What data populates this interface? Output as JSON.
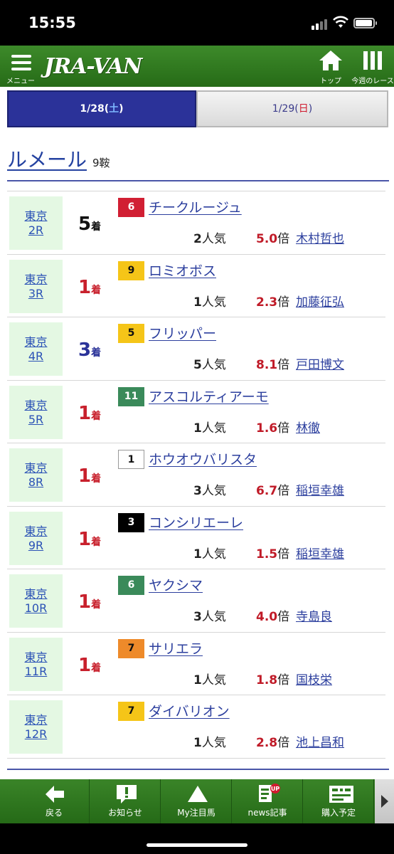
{
  "status_bar": {
    "time": "15:55"
  },
  "header": {
    "menu_label": "メニュー",
    "logo": "JRA-VAN",
    "top_label": "トップ",
    "week_label": "今週のレース"
  },
  "tabs": [
    {
      "date": "1/28",
      "dow": "土"
    },
    {
      "date": "1/29",
      "dow": "日"
    }
  ],
  "jockey": {
    "name": "ルメール",
    "rides": "9鞍"
  },
  "colors": {
    "header_green": "#2f7a20",
    "accent_blue": "#2b3299",
    "odds_red": "#c01b28"
  },
  "races": [
    {
      "venue": "東京",
      "race": "2R",
      "place": "5",
      "place_unit": "着",
      "place_color": "#111111",
      "gate": "6",
      "gate_bg": "#d11f33",
      "gate_fg": "#ffffff",
      "horse": "チークルージュ",
      "pop": "2",
      "pop_unit": "人気",
      "odds": "5.0",
      "odds_unit": "倍",
      "rider": "木村哲也"
    },
    {
      "venue": "東京",
      "race": "3R",
      "place": "1",
      "place_unit": "着",
      "place_color": "#c8202c",
      "gate": "9",
      "gate_bg": "#f5c518",
      "gate_fg": "#111111",
      "horse": "ロミオボス",
      "pop": "1",
      "pop_unit": "人気",
      "odds": "2.3",
      "odds_unit": "倍",
      "rider": "加藤征弘"
    },
    {
      "venue": "東京",
      "race": "4R",
      "place": "3",
      "place_unit": "着",
      "place_color": "#2b3399",
      "gate": "5",
      "gate_bg": "#f5c518",
      "gate_fg": "#111111",
      "horse": "フリッパー",
      "pop": "5",
      "pop_unit": "人気",
      "odds": "8.1",
      "odds_unit": "倍",
      "rider": "戸田博文"
    },
    {
      "venue": "東京",
      "race": "5R",
      "place": "1",
      "place_unit": "着",
      "place_color": "#c8202c",
      "gate": "11",
      "gate_bg": "#3a8a5a",
      "gate_fg": "#ffffff",
      "horse": "アスコルティアーモ",
      "pop": "1",
      "pop_unit": "人気",
      "odds": "1.6",
      "odds_unit": "倍",
      "rider": "林徹"
    },
    {
      "venue": "東京",
      "race": "8R",
      "place": "1",
      "place_unit": "着",
      "place_color": "#c8202c",
      "gate": "1",
      "gate_bg": "#ffffff",
      "gate_fg": "#111111",
      "horse": "ホウオウバリスタ",
      "pop": "3",
      "pop_unit": "人気",
      "odds": "6.7",
      "odds_unit": "倍",
      "rider": "稲垣幸雄"
    },
    {
      "venue": "東京",
      "race": "9R",
      "place": "1",
      "place_unit": "着",
      "place_color": "#c8202c",
      "gate": "3",
      "gate_bg": "#000000",
      "gate_fg": "#ffffff",
      "horse": "コンシリエーレ",
      "pop": "1",
      "pop_unit": "人気",
      "odds": "1.5",
      "odds_unit": "倍",
      "rider": "稲垣幸雄"
    },
    {
      "venue": "東京",
      "race": "10R",
      "place": "1",
      "place_unit": "着",
      "place_color": "#c8202c",
      "gate": "6",
      "gate_bg": "#3a8a5a",
      "gate_fg": "#ffffff",
      "horse": "ヤクシマ",
      "pop": "3",
      "pop_unit": "人気",
      "odds": "4.0",
      "odds_unit": "倍",
      "rider": "寺島良"
    },
    {
      "venue": "東京",
      "race": "11R",
      "place": "1",
      "place_unit": "着",
      "place_color": "#c8202c",
      "gate": "7",
      "gate_bg": "#ee8a2a",
      "gate_fg": "#111111",
      "horse": "サリエラ",
      "pop": "1",
      "pop_unit": "人気",
      "odds": "1.8",
      "odds_unit": "倍",
      "rider": "国枝栄"
    },
    {
      "venue": "東京",
      "race": "12R",
      "place": "",
      "place_unit": "",
      "place_color": "#111111",
      "gate": "7",
      "gate_bg": "#f5c518",
      "gate_fg": "#111111",
      "horse": "ダイバリオン",
      "pop": "1",
      "pop_unit": "人気",
      "odds": "2.8",
      "odds_unit": "倍",
      "rider": "池上昌和"
    }
  ],
  "bottom_nav": [
    {
      "label": "戻る",
      "icon": "back-arrow-icon"
    },
    {
      "label": "お知らせ",
      "icon": "notice-icon"
    },
    {
      "label": "My注目馬",
      "icon": "my-horse-icon"
    },
    {
      "label": "news記事",
      "icon": "news-icon",
      "badge": "UP"
    },
    {
      "label": "購入予定",
      "icon": "purchase-plan-icon"
    }
  ]
}
